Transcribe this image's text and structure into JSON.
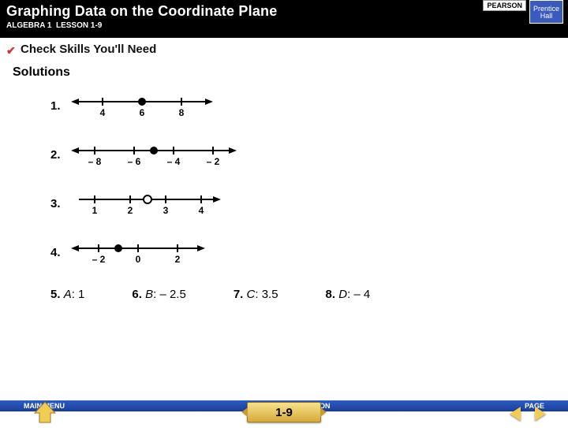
{
  "header": {
    "title": "Graphing Data on the Coordinate Plane",
    "course": "ALGEBRA 1",
    "lesson": "LESSON 1-9"
  },
  "brand": {
    "pearson": "PEARSON",
    "prentice1": "Prentice",
    "prentice2": "Hall"
  },
  "check": {
    "label": "Check Skills You'll Need"
  },
  "solutions_label": "Solutions",
  "nl": [
    {
      "num": "1.",
      "ticks": [
        "4",
        "6",
        "8"
      ],
      "dot_index": 1,
      "left_arrow": true,
      "right_arrow": true,
      "open": false
    },
    {
      "num": "2.",
      "ticks": [
        "– 8",
        "– 6",
        "– 4",
        "– 2"
      ],
      "dot_between": [
        1,
        2
      ],
      "left_arrow": true,
      "right_arrow": true,
      "open": false
    },
    {
      "num": "3.",
      "ticks": [
        "1",
        "2",
        "3",
        "4"
      ],
      "dot_between": [
        1,
        2
      ],
      "left_arrow": false,
      "right_arrow": true,
      "open": true
    },
    {
      "num": "4.",
      "ticks": [
        "– 2",
        "0",
        "2"
      ],
      "dot_index": 0.5,
      "left_arrow": true,
      "right_arrow": true,
      "open": false,
      "dot_between": [
        0,
        1
      ]
    }
  ],
  "answers": [
    {
      "n": "5.",
      "v": "A",
      "val": "1"
    },
    {
      "n": "6.",
      "v": "B",
      "val": "– 2.5"
    },
    {
      "n": "7.",
      "v": "C",
      "val": "3.5"
    },
    {
      "n": "8.",
      "v": "D",
      "val": "– 4"
    }
  ],
  "footer": {
    "main": "MAIN MENU",
    "lesson": "LESSON",
    "page": "PAGE",
    "badge": "1-9"
  }
}
